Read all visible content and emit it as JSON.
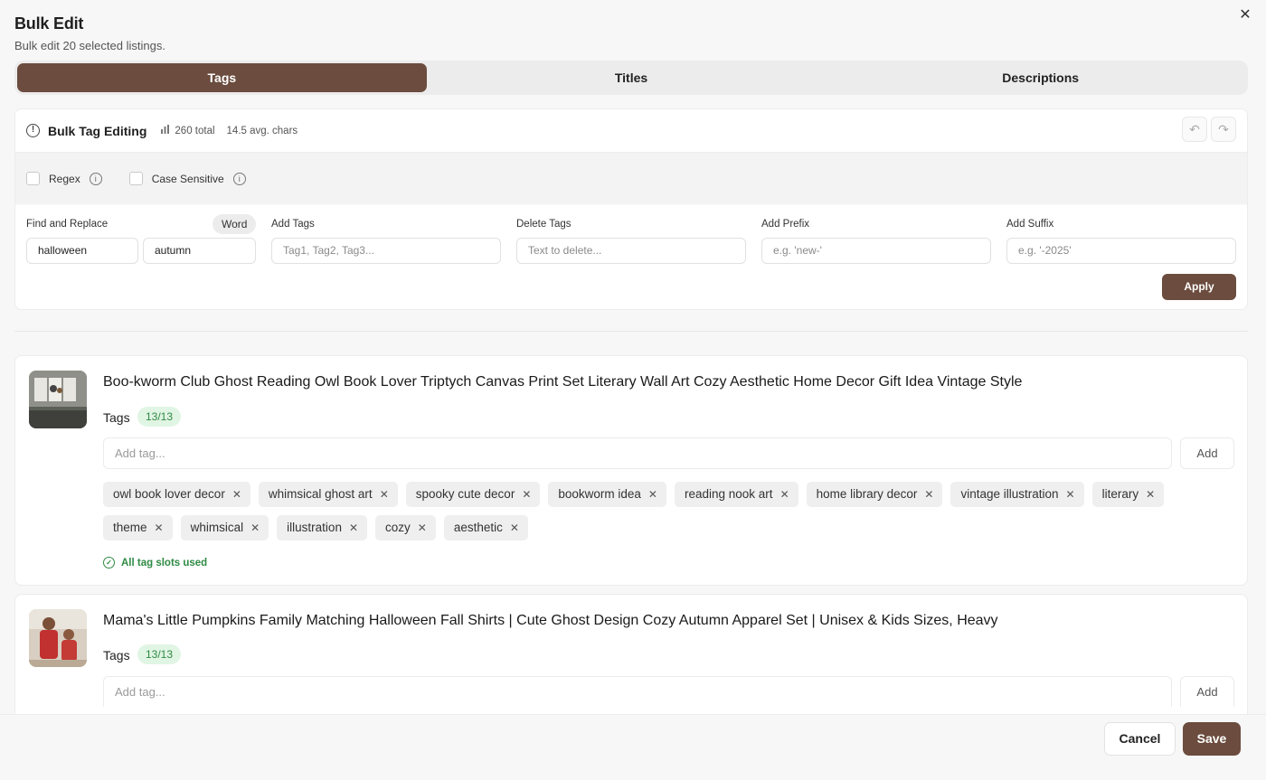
{
  "dialog": {
    "title": "Bulk Edit",
    "subtitle": "Bulk edit 20 selected listings.",
    "close_icon": "close-icon"
  },
  "tabs": [
    {
      "label": "Tags",
      "active": true
    },
    {
      "label": "Titles",
      "active": false
    },
    {
      "label": "Descriptions",
      "active": false
    }
  ],
  "tool": {
    "title": "Bulk Tag Editing",
    "total": "260 total",
    "avg": "14.5 avg. chars",
    "undo_icon": "undo-icon",
    "redo_icon": "redo-icon"
  },
  "options": {
    "regex_label": "Regex",
    "case_label": "Case Sensitive",
    "regex_checked": false,
    "case_checked": false
  },
  "fields": {
    "find_replace_label": "Find and Replace",
    "word_label": "Word",
    "find_value": "halloween",
    "replace_value": "autumn",
    "add_tags_label": "Add Tags",
    "add_tags_placeholder": "Tag1, Tag2, Tag3...",
    "delete_tags_label": "Delete Tags",
    "delete_tags_placeholder": "Text to delete...",
    "add_prefix_label": "Add Prefix",
    "add_prefix_placeholder": "e.g. 'new-'",
    "add_suffix_label": "Add Suffix",
    "add_suffix_placeholder": "e.g. '-2025'",
    "apply_label": "Apply"
  },
  "listings": [
    {
      "title": "Boo-kworm Club Ghost Reading Owl Book Lover Triptych Canvas Print Set Literary Wall Art Cozy Aesthetic Home Decor Gift Idea Vintage Style",
      "tags_label": "Tags",
      "count": "13/13",
      "add_placeholder": "Add tag...",
      "add_label": "Add",
      "tags": [
        "owl book lover decor",
        "whimsical ghost art",
        "spooky cute decor",
        "bookworm idea",
        "reading nook art",
        "home library decor",
        "vintage illustration",
        "literary",
        "theme",
        "whimsical",
        "illustration",
        "cozy",
        "aesthetic"
      ],
      "status": "All tag slots used"
    },
    {
      "title": "Mama's Little Pumpkins Family Matching Halloween Fall Shirts | Cute Ghost Design Cozy Autumn Apparel Set | Unisex & Kids Sizes, Heavy",
      "tags_label": "Tags",
      "count": "13/13",
      "add_placeholder": "Add tag...",
      "add_label": "Add"
    }
  ],
  "footer": {
    "cancel_label": "Cancel",
    "save_label": "Save"
  },
  "colors": {
    "accent": "#6b4c3e",
    "success": "#2f8a44",
    "success_bg": "#e1f5e4"
  }
}
